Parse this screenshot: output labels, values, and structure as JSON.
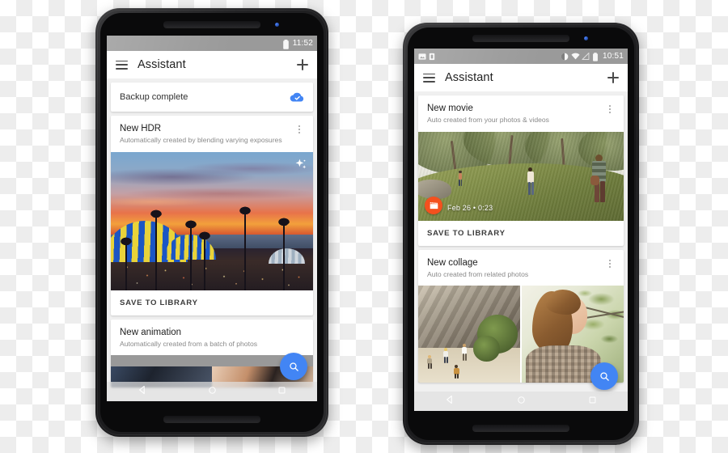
{
  "scene": {
    "background": "transparent-checkerboard",
    "device_count": 2
  },
  "phone_left": {
    "device_name": "android-phone-left",
    "statusbar": {
      "clock": "11:52",
      "icons": [
        "battery-icon"
      ]
    },
    "appbar": {
      "menu_icon": "hamburger-menu-icon",
      "title": "Assistant",
      "action_icon": "plus-icon"
    },
    "cards": [
      {
        "type": "status-row",
        "label": "Backup complete",
        "icon": "cloud-done-icon",
        "icon_color": "#4285f4"
      },
      {
        "type": "suggestion",
        "title": "New HDR",
        "subtitle": "Automatically created by blending varying exposures",
        "overflow_icon": "kebab-menu-icon",
        "media": "hdr-sunset-palm-trees-photo",
        "media_badge": "sparkle-icon",
        "action_label": "SAVE TO LIBRARY"
      },
      {
        "type": "suggestion",
        "title": "New animation",
        "subtitle": "Automatically created from a batch of photos",
        "media": "animation-filmstrip-photo"
      }
    ],
    "fab": {
      "icon": "search-icon",
      "color": "#4285f4"
    },
    "navbar": {
      "back_icon": "back-triangle-icon",
      "home_icon": "home-circle-icon",
      "recents_icon": "recents-square-icon"
    }
  },
  "phone_right": {
    "device_name": "android-phone-right",
    "statusbar": {
      "clock": "10:51",
      "left_icons": [
        "screenshot-icon",
        "sim-card-icon"
      ],
      "right_icons": [
        "do-not-disturb-icon",
        "wifi-icon",
        "signal-off-icon",
        "battery-icon"
      ]
    },
    "appbar": {
      "menu_icon": "hamburger-menu-icon",
      "title": "Assistant",
      "action_icon": "plus-icon"
    },
    "cards": [
      {
        "type": "suggestion",
        "title": "New movie",
        "subtitle": "Auto created from your photos & videos",
        "overflow_icon": "kebab-menu-icon",
        "media": "hikers-on-grassy-hillside-photo",
        "badge_icon": "movie-clapper-icon",
        "badge_color": "#f4511e",
        "media_meta": "Feb 26 • 0:23",
        "action_label": "SAVE TO LIBRARY"
      },
      {
        "type": "suggestion",
        "title": "New collage",
        "subtitle": "Auto created from related photos",
        "overflow_icon": "kebab-menu-icon",
        "media_left": "canyon-climbers-photo",
        "media_right": "smiling-woman-outdoors-photo"
      }
    ],
    "fab": {
      "icon": "search-icon",
      "color": "#4285f4"
    },
    "navbar": {
      "back_icon": "back-triangle-icon",
      "home_icon": "home-circle-icon",
      "recents_icon": "recents-square-icon"
    }
  }
}
